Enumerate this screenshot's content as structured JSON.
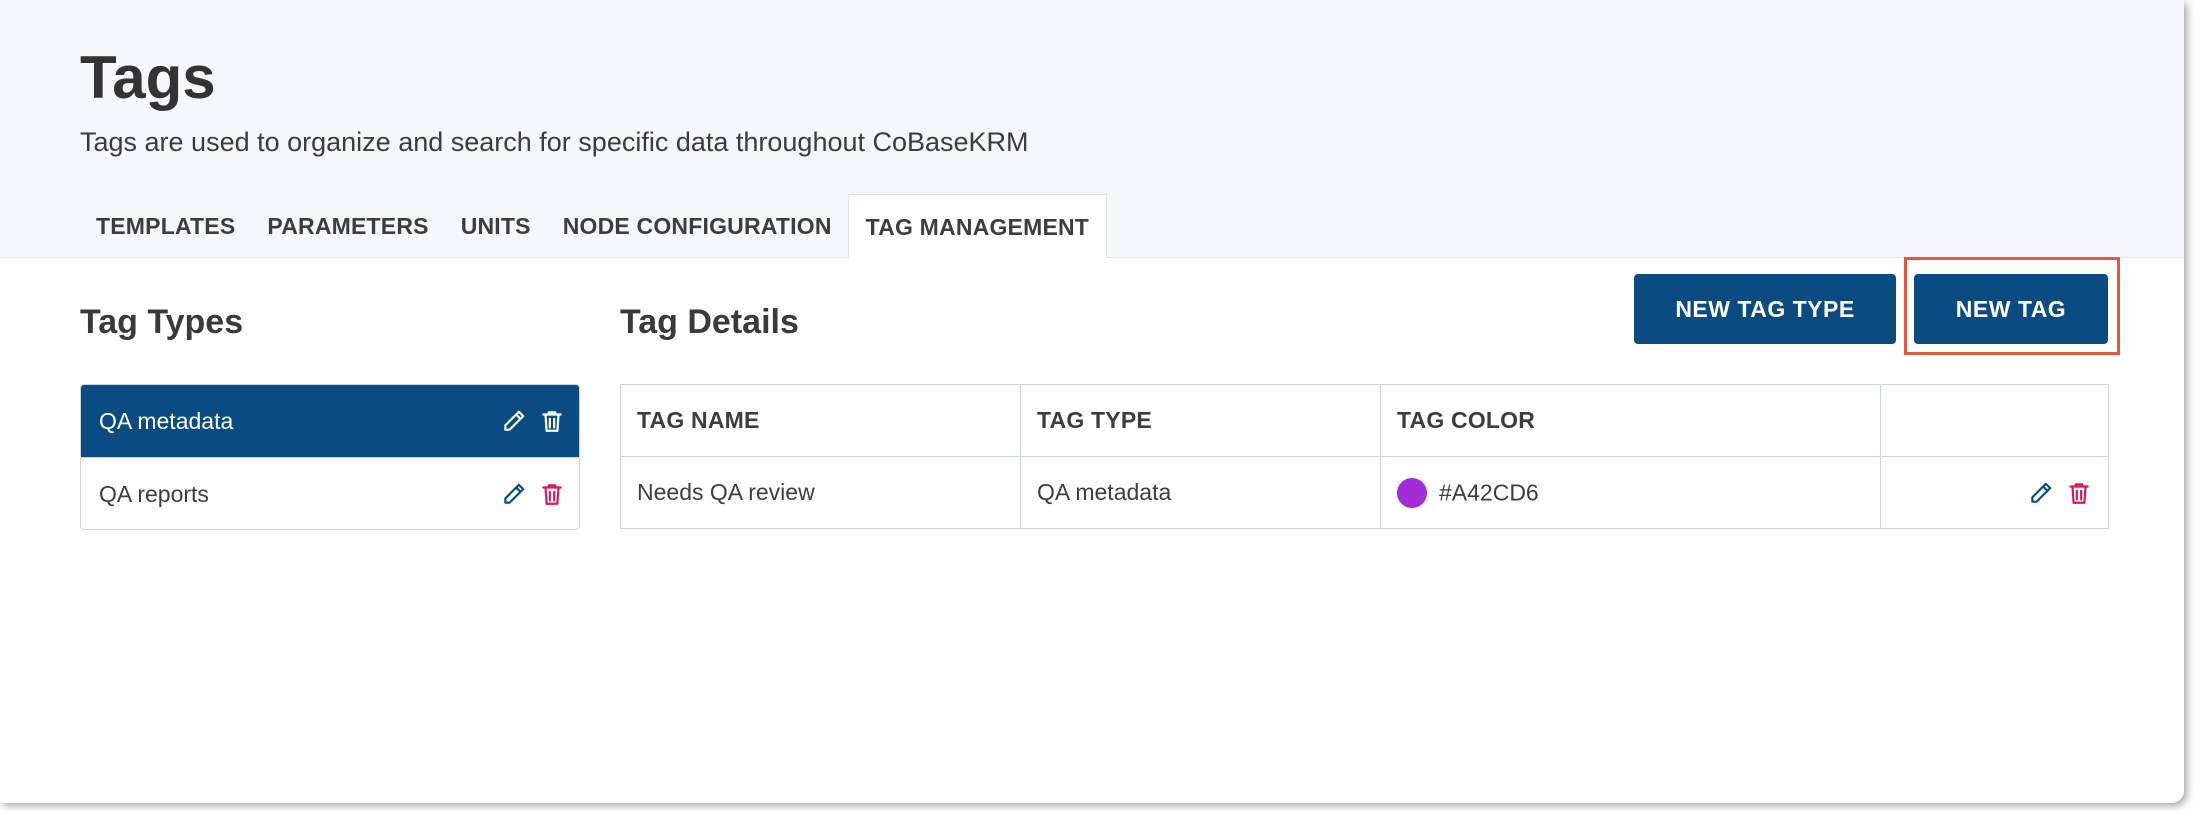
{
  "page": {
    "title": "Tags",
    "subtitle": "Tags are used to organize and search for specific data throughout CoBaseKRM"
  },
  "tabs": [
    {
      "label": "TEMPLATES",
      "active": false
    },
    {
      "label": "PARAMETERS",
      "active": false
    },
    {
      "label": "UNITS",
      "active": false
    },
    {
      "label": "NODE CONFIGURATION",
      "active": false
    },
    {
      "label": "TAG MANAGEMENT",
      "active": true
    }
  ],
  "tag_types": {
    "heading": "Tag Types",
    "items": [
      {
        "label": "QA metadata",
        "selected": true,
        "icons": [
          "pencil-icon",
          "trash-icon"
        ]
      },
      {
        "label": "QA reports",
        "selected": false,
        "icons": [
          "pencil-icon",
          "trash-icon"
        ]
      }
    ]
  },
  "tag_details": {
    "heading": "Tag Details",
    "columns": [
      "TAG NAME",
      "TAG TYPE",
      "TAG COLOR",
      ""
    ],
    "rows": [
      {
        "name": "Needs QA review",
        "type": "QA metadata",
        "color": "#A42CD6",
        "color_label": "#A42CD6"
      }
    ]
  },
  "actions": {
    "new_tag_type": "NEW TAG TYPE",
    "new_tag": "NEW TAG"
  },
  "colors": {
    "primary": "#0A4C82",
    "edit_icon": "#0A4C82",
    "delete_icon": "#D6175F",
    "highlight": "#E8553F",
    "header_bg": "#F6F7FB"
  }
}
